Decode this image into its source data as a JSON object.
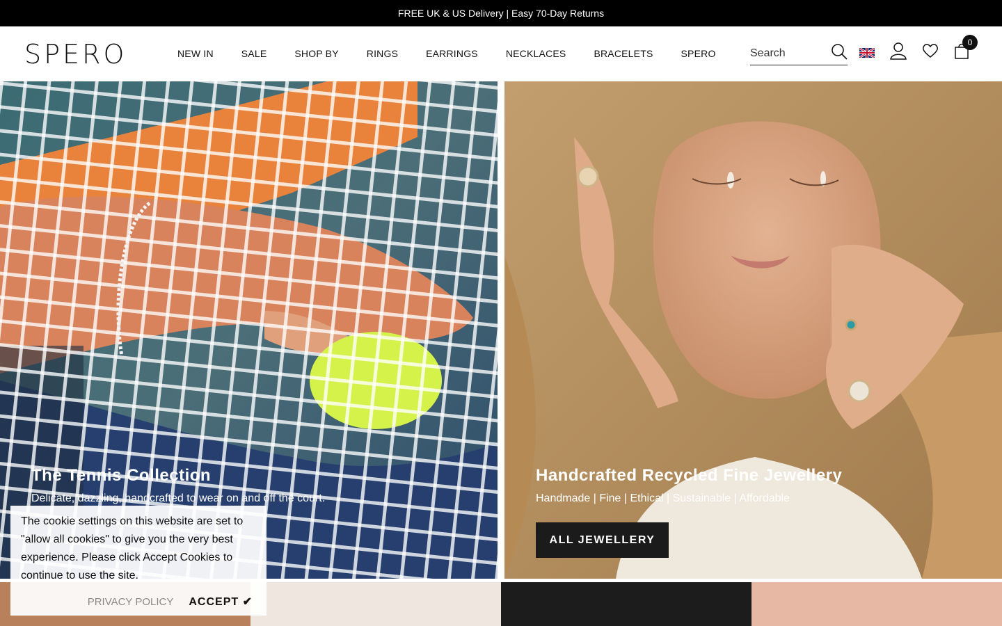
{
  "announcement": "FREE UK & US Delivery | Easy 70-Day Returns",
  "brand": "SPERO",
  "nav": [
    "NEW IN",
    "SALE",
    "SHOP BY",
    "RINGS",
    "EARRINGS",
    "NECKLACES",
    "BRACELETS",
    "SPERO"
  ],
  "search": {
    "placeholder": "Search"
  },
  "cart": {
    "count": "0"
  },
  "heroes": [
    {
      "title": "The Tennis Collection",
      "subtitle": "Delicate, dazzling, handcrafted to wear on and off the court."
    },
    {
      "title": "Handcrafted Recycled Fine Jewellery",
      "subtitle": "Handmade | Fine | Ethical | Sustainable | Affordable",
      "button": "ALL JEWELLERY"
    }
  ],
  "cookie": {
    "text": "The cookie settings on this website are set to \"allow all cookies\" to give you the very best experience. Please click Accept Cookies to continue to use the site.",
    "privacy": "PRIVACY POLICY",
    "accept": "ACCEPT"
  },
  "icons": [
    "search-icon",
    "uk-flag-icon",
    "account-icon",
    "wishlist-icon",
    "cart-icon",
    "checkmark-icon"
  ]
}
